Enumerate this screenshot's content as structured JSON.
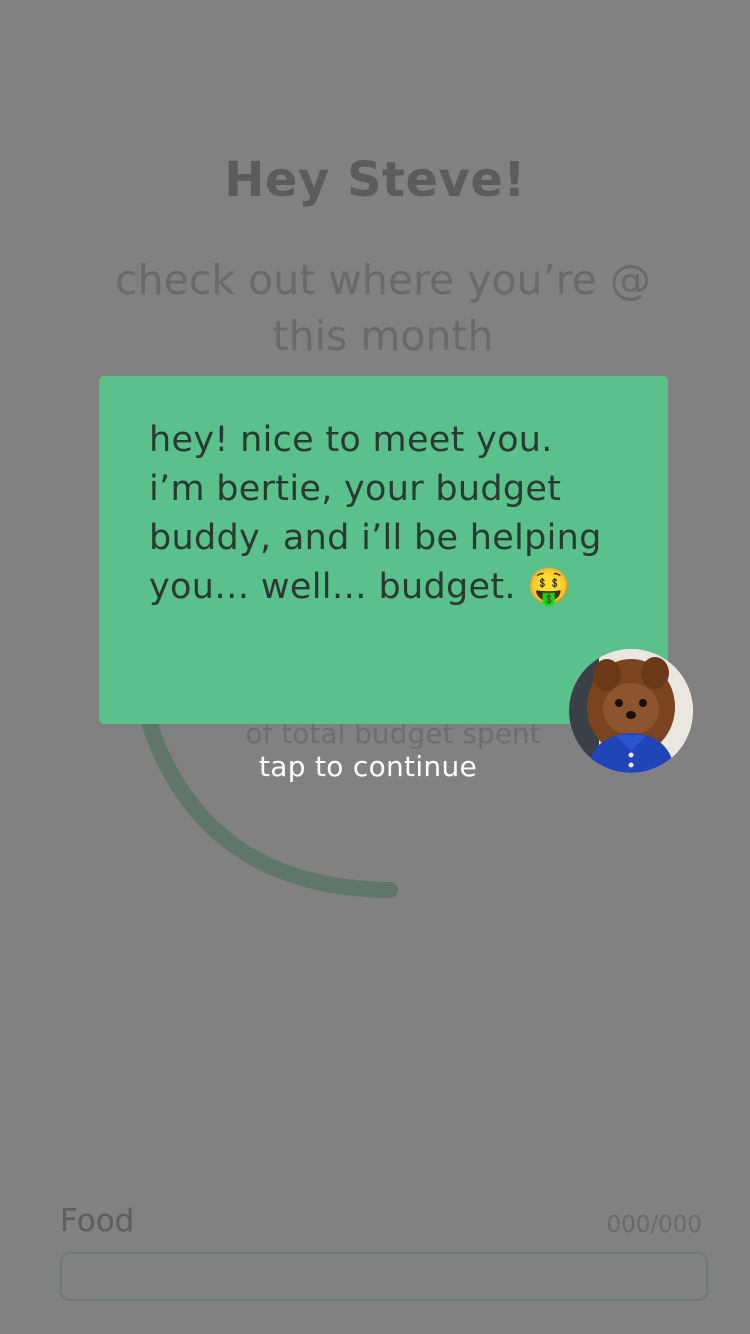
{
  "header": {
    "greeting": "Hey Steve!",
    "subtitle": "check out where you’re @ this month"
  },
  "budget_ring": {
    "caption": "of total budget spent",
    "color": "#5f7668"
  },
  "onboarding": {
    "message": "hey! nice to meet you. i’m bertie, your budget buddy, and i’ll be helping you… well… budget. 🤑",
    "bubble_color": "#5ac08c",
    "mascot_icon": "dog-avatar-icon",
    "tap_hint": "tap to continue"
  },
  "categories": [
    {
      "label": "Food",
      "amount": "000/000"
    }
  ]
}
